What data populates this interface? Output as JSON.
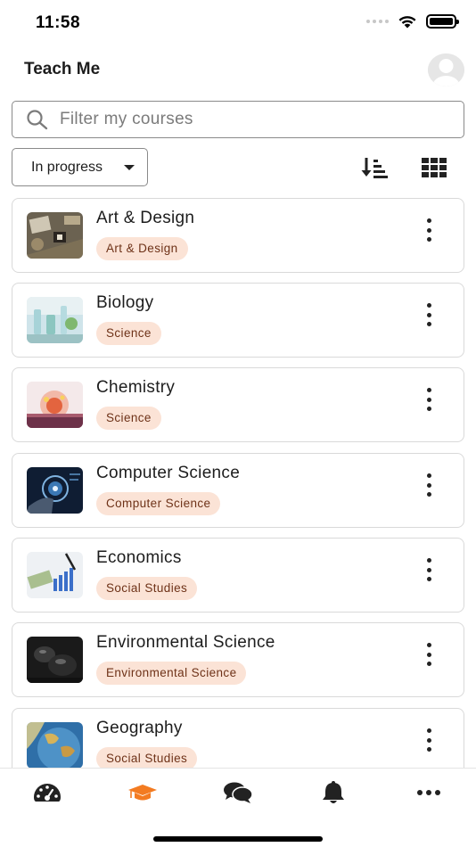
{
  "status_bar": {
    "time": "11:58"
  },
  "header": {
    "title": "Teach Me"
  },
  "search": {
    "placeholder": "Filter my courses",
    "value": ""
  },
  "filter": {
    "selected": "In progress"
  },
  "courses": [
    {
      "name": "Art & Design",
      "category": "Art & Design"
    },
    {
      "name": "Biology",
      "category": "Science"
    },
    {
      "name": "Chemistry",
      "category": "Science"
    },
    {
      "name": "Computer Science",
      "category": "Computer Science"
    },
    {
      "name": "Economics",
      "category": "Social Studies"
    },
    {
      "name": "Environmental Science",
      "category": "Environmental Science"
    },
    {
      "name": "Geography",
      "category": "Social Studies"
    }
  ],
  "bottom_nav": {
    "items": [
      {
        "icon": "dashboard-icon",
        "active": false
      },
      {
        "icon": "graduation-cap-icon",
        "active": true
      },
      {
        "icon": "chat-bubbles-icon",
        "active": false
      },
      {
        "icon": "bell-icon",
        "active": false
      },
      {
        "icon": "more-dots-icon",
        "active": false
      }
    ]
  },
  "colors": {
    "accent": "#f37b21",
    "badge_bg": "#fbe3d6",
    "badge_text": "#6e3218",
    "card_border": "#d9d9d9"
  }
}
